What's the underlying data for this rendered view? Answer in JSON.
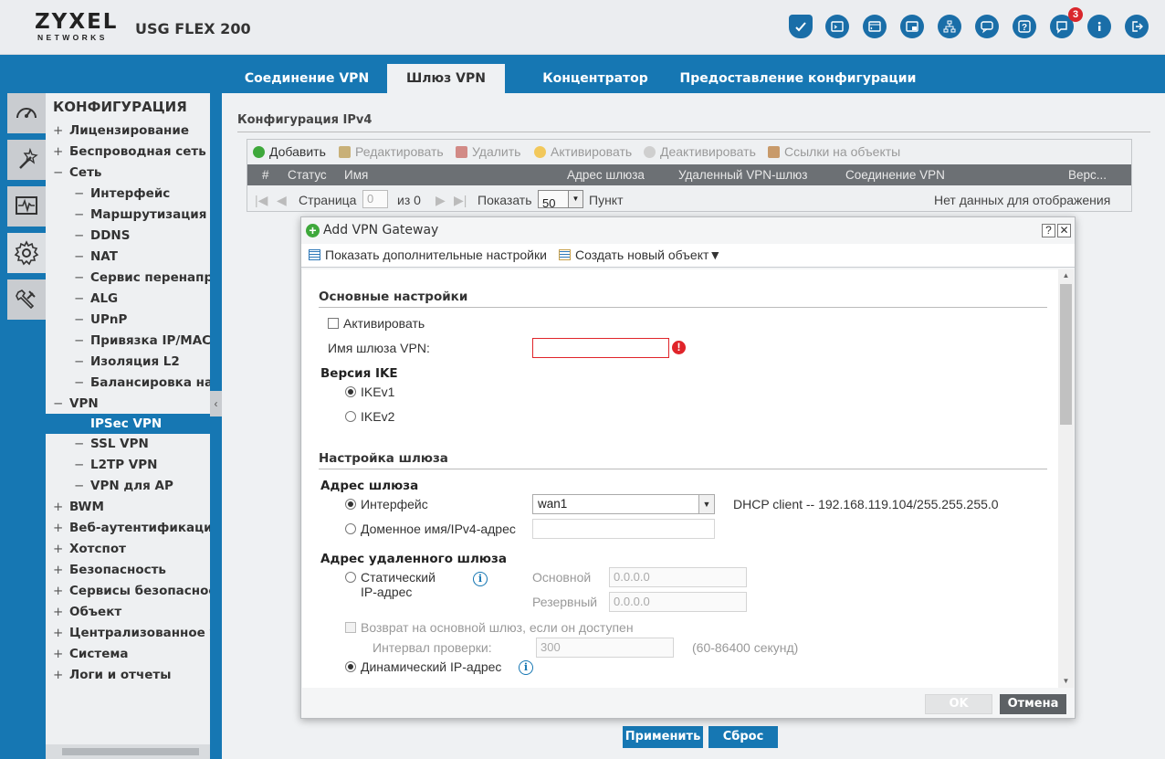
{
  "header": {
    "brand": "ZYXEL",
    "brand_sub": "NETWORKS",
    "model": "USG FLEX 200",
    "notification_count": "3",
    "icons": [
      "shield-icon",
      "console-icon",
      "cli-icon",
      "window-icon",
      "sitemap-icon",
      "chat-icon",
      "help-icon",
      "notification-icon",
      "info-icon",
      "logout-icon"
    ]
  },
  "tabs": [
    "Соединение VPN",
    "Шлюз VPN",
    "Концентратор",
    "Предоставление конфигурации"
  ],
  "active_tab": "Шлюз VPN",
  "rail": [
    "dashboard-icon",
    "wizard-icon",
    "monitor-icon",
    "configuration-icon",
    "maintenance-icon"
  ],
  "nav": {
    "title": "КОНФИГУРАЦИЯ",
    "items": [
      {
        "prefix": "+",
        "label": "Лицензирование"
      },
      {
        "prefix": "+",
        "label": "Беспроводная сеть"
      },
      {
        "prefix": "−",
        "label": "Сеть"
      },
      {
        "prefix": "−",
        "label": "Интерфейс"
      },
      {
        "prefix": "−",
        "label": "Маршрутизация"
      },
      {
        "prefix": "−",
        "label": "DDNS"
      },
      {
        "prefix": "−",
        "label": "NAT"
      },
      {
        "prefix": "−",
        "label": "Сервис перенапра"
      },
      {
        "prefix": "−",
        "label": "ALG"
      },
      {
        "prefix": "−",
        "label": "UPnP"
      },
      {
        "prefix": "−",
        "label": "Привязка IP/MAC"
      },
      {
        "prefix": "−",
        "label": "Изоляция L2"
      },
      {
        "prefix": "−",
        "label": "Балансировка наг"
      },
      {
        "prefix": "−",
        "label": "VPN"
      },
      {
        "prefix": "",
        "label": "IPSec VPN"
      },
      {
        "prefix": "−",
        "label": "SSL VPN"
      },
      {
        "prefix": "−",
        "label": "L2TP VPN"
      },
      {
        "prefix": "−",
        "label": "VPN для AP"
      },
      {
        "prefix": "+",
        "label": "BWM"
      },
      {
        "prefix": "+",
        "label": "Веб-аутентификация"
      },
      {
        "prefix": "+",
        "label": "Хотспот"
      },
      {
        "prefix": "+",
        "label": "Безопасность"
      },
      {
        "prefix": "+",
        "label": "Сервисы безопасност"
      },
      {
        "prefix": "+",
        "label": "Объект"
      },
      {
        "prefix": "+",
        "label": "Централизованное уп"
      },
      {
        "prefix": "+",
        "label": "Система"
      },
      {
        "prefix": "+",
        "label": "Логи и отчеты"
      }
    ]
  },
  "main": {
    "section_title": "Конфигурация IPv4",
    "toolbar": {
      "add": "Добавить",
      "edit": "Редактировать",
      "delete": "Удалить",
      "activate": "Активировать",
      "deactivate": "Деактивировать",
      "references": "Ссылки на объекты"
    },
    "columns": [
      "#",
      "Статус",
      "Имя",
      "Адрес шлюза",
      "Удаленный VPN-шлюз",
      "Соединение VPN",
      "Верс..."
    ],
    "pager": {
      "page_label": "Страница",
      "page_value": "0",
      "of_label": "из 0",
      "show_label": "Показать",
      "page_size": "50",
      "unit_label": "Пункт",
      "empty_text": "Нет данных для отображения"
    },
    "apply": "Применить",
    "reset": "Сброс"
  },
  "dialog": {
    "title": "Add VPN Gateway",
    "help_btn": "?",
    "close_btn": "✕",
    "tool_show_advanced": "Показать дополнительные настройки",
    "tool_create_object": "Создать новый объект▼",
    "sec_basic": "Основные настройки",
    "activate_label": "Активировать",
    "gw_name_label": "Имя шлюза VPN:",
    "gw_name_value": "",
    "ike_version_label": "Версия IKE",
    "ikev1": "IKEv1",
    "ikev2": "IKEv2",
    "sec_gateway": "Настройка шлюза",
    "gw_address_label": "Адрес шлюза",
    "interface_label": "Интерфейс",
    "interface_value": "wan1",
    "interface_info": "DHCP client -- 192.168.119.104/255.255.255.0",
    "domain_label": "Доменное имя/IPv4-адрес",
    "remote_label": "Адрес удаленного шлюза",
    "static_label_1": "Статический",
    "static_label_2": "IP-адрес",
    "primary_label": "Основной",
    "primary_value": "0.0.0.0",
    "backup_label": "Резервный",
    "backup_value": "0.0.0.0",
    "fallback_label": "Возврат на основной шлюз, если он доступен",
    "check_interval_label": "Интервал проверки:",
    "check_interval_value": "300",
    "check_interval_range": "(60-86400 секунд)",
    "dynamic_label": "Динамический IP-адрес",
    "ok": "OK",
    "cancel": "Отмена"
  },
  "colors": {
    "accent": "#1677b3",
    "header_bg": "#ebedf0",
    "error": "#e0242a",
    "add_green": "#3ea83b"
  }
}
